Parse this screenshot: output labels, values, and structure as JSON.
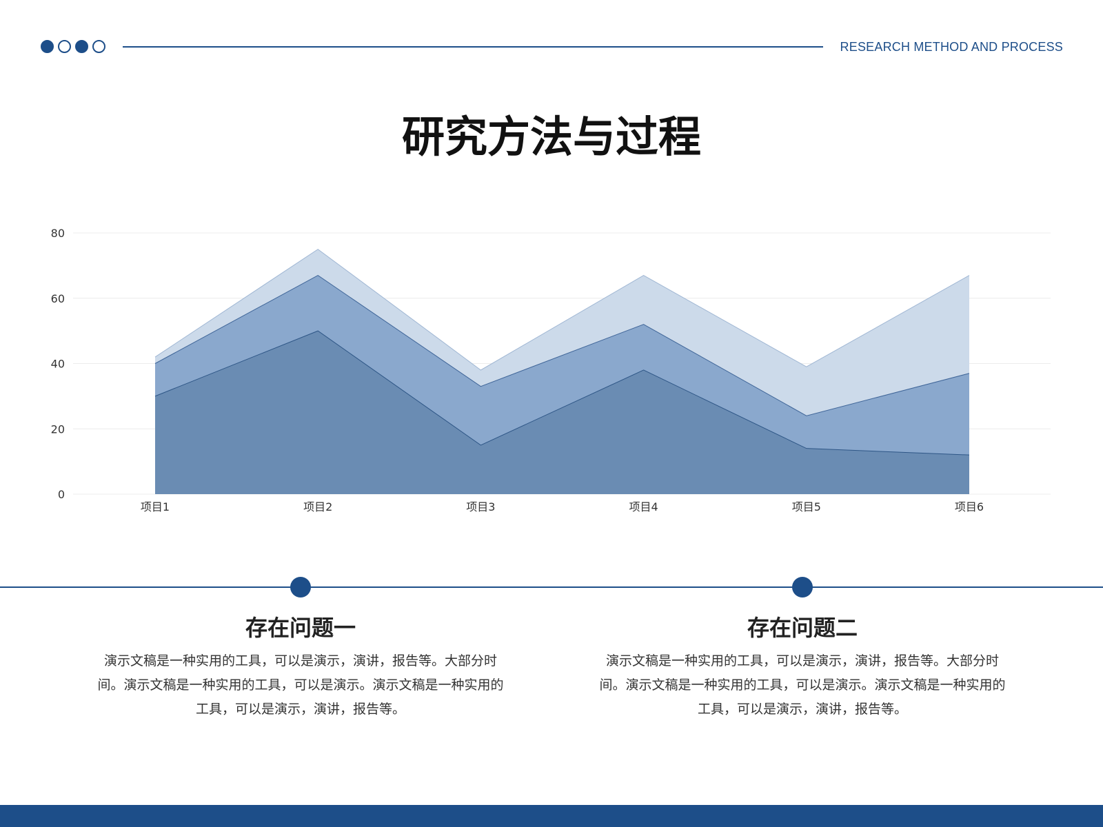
{
  "header": {
    "label": "RESEARCH METHOD AND PROCESS",
    "dots": [
      "filled",
      "hollow",
      "filled",
      "hollow"
    ]
  },
  "title": "研究方法与过程",
  "colors": {
    "accent": "#1d4e89",
    "series1": "#6a8cb3",
    "series2": "#8aa8cd",
    "series3": "#ccdaea",
    "grid": "#ececec"
  },
  "chart_data": {
    "type": "area",
    "categories": [
      "项目1",
      "项目2",
      "项目3",
      "项目4",
      "项目5",
      "项目6"
    ],
    "series": [
      {
        "values": [
          30,
          50,
          15,
          38,
          14,
          12
        ]
      },
      {
        "values": [
          40,
          67,
          33,
          52,
          24,
          37
        ]
      },
      {
        "values": [
          42,
          75,
          38,
          67,
          39,
          67
        ]
      }
    ],
    "yticks": [
      0,
      20,
      40,
      60,
      80
    ],
    "ylim": [
      0,
      80
    ],
    "grid": true,
    "legend": "none"
  },
  "sections": [
    {
      "title": "存在问题一",
      "body": "演示文稿是一种实用的工具，可以是演示，演讲，报告等。大部分时间。演示文稿是一种实用的工具，可以是演示。演示文稿是一种实用的工具，可以是演示，演讲，报告等。"
    },
    {
      "title": "存在问题二",
      "body": "演示文稿是一种实用的工具，可以是演示，演讲，报告等。大部分时间。演示文稿是一种实用的工具，可以是演示。演示文稿是一种实用的工具，可以是演示，演讲，报告等。"
    }
  ]
}
